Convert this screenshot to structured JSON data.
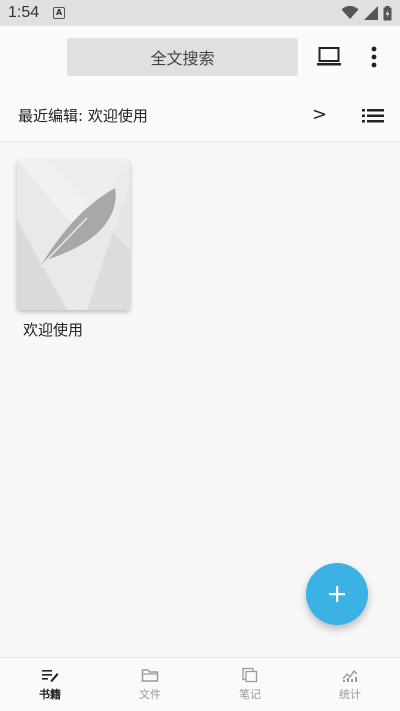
{
  "status": {
    "time": "1:54",
    "notification_letter": "A"
  },
  "top_bar": {
    "search_placeholder": "全文搜索",
    "laptop_icon": "laptop-icon",
    "more_icon": "more-vertical-icon"
  },
  "recent": {
    "label": "最近编辑: 欢迎使用",
    "chevron": ">"
  },
  "books": [
    {
      "title": "欢迎使用",
      "cover_icon": "feather-icon"
    }
  ],
  "fab": {
    "icon": "plus-icon"
  },
  "bottom_nav": {
    "items": [
      {
        "label": "书籍",
        "icon": "books-icon",
        "active": true
      },
      {
        "label": "文件",
        "icon": "folder-icon",
        "active": false
      },
      {
        "label": "笔记",
        "icon": "notes-icon",
        "active": false
      },
      {
        "label": "统计",
        "icon": "stats-icon",
        "active": false
      }
    ]
  },
  "colors": {
    "fab": "#3ab2e3",
    "search_bg": "#e0e0e0",
    "status_bg": "#e0e0e0"
  }
}
